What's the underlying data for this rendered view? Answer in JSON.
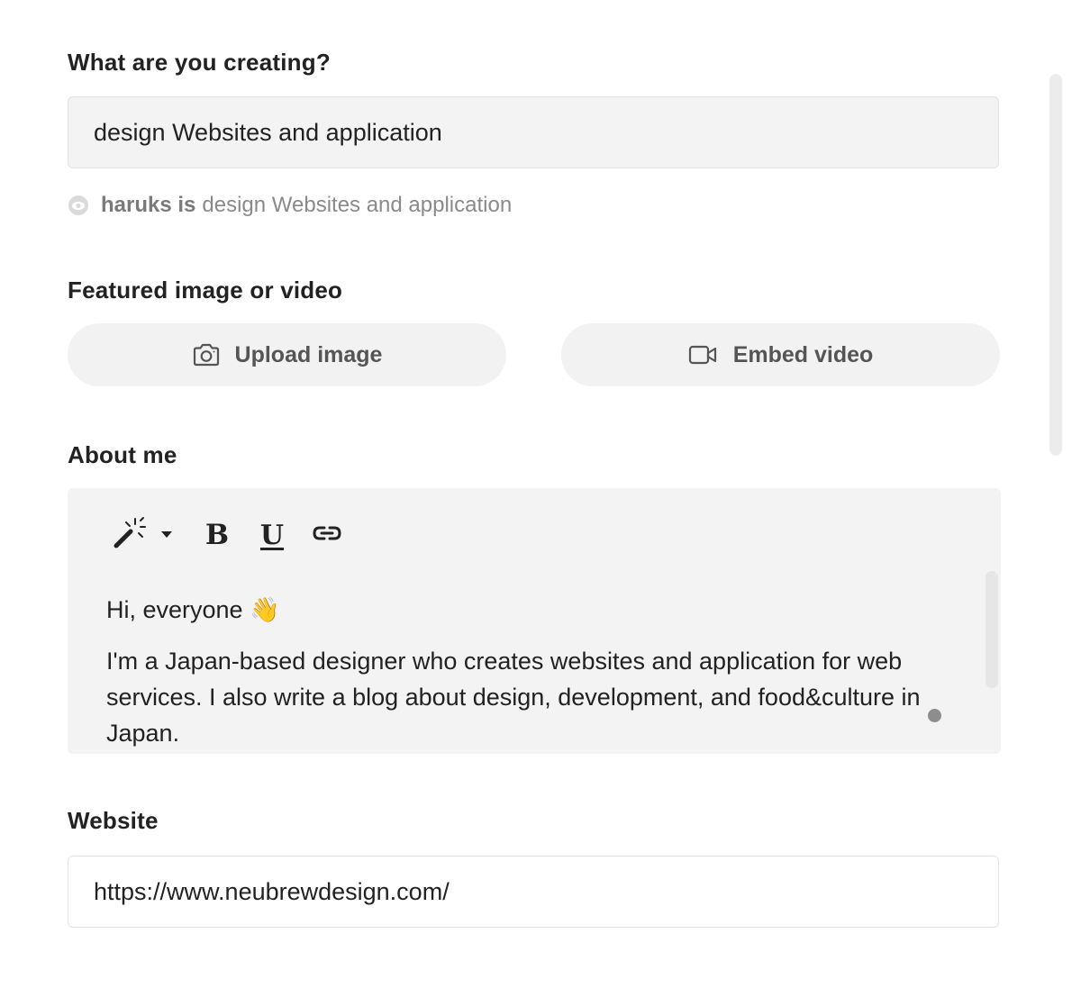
{
  "creating": {
    "label": "What are you creating?",
    "value": "design Websites and application",
    "preview_user": "haruks is",
    "preview_text": "design Websites and application",
    "preview_icon": "eye-icon"
  },
  "featured": {
    "label": "Featured image or video",
    "upload_label": "Upload image",
    "upload_icon": "camera-icon",
    "embed_label": "Embed video",
    "embed_icon": "video-camera-icon"
  },
  "about": {
    "label": "About me",
    "toolbar": {
      "magic_icon": "magic-wand-icon",
      "bold_label": "B",
      "underline_label": "U",
      "link_icon": "link-icon"
    },
    "greeting": "Hi, everyone 👋",
    "body": "I'm a Japan-based designer who creates websites and application for web services. I also write a blog about design, development, and food&culture in Japan."
  },
  "website": {
    "label": "Website",
    "value": "https://www.neubrewdesign.com/"
  }
}
